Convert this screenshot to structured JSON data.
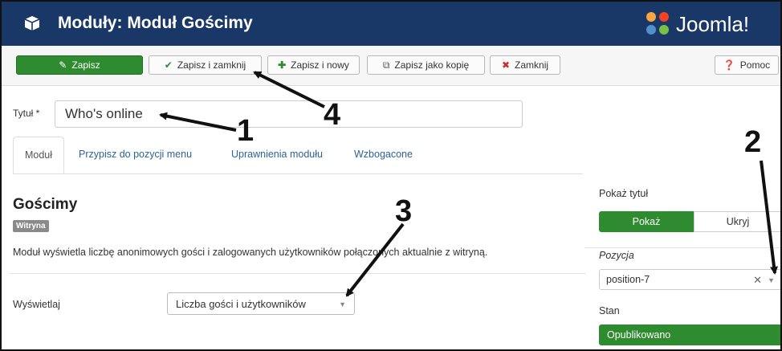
{
  "header": {
    "title": "Moduły: Moduł Gościmy",
    "brand": "Joomla!"
  },
  "toolbar": {
    "save": "Zapisz",
    "save_close": "Zapisz i zamknij",
    "save_new": "Zapisz i nowy",
    "save_copy": "Zapisz jako kopię",
    "close": "Zamknij",
    "help": "Pomoc"
  },
  "form": {
    "title_label": "Tytuł *",
    "title_value": "Who's online"
  },
  "tabs": [
    "Moduł",
    "Przypisz do pozycji menu",
    "Uprawnienia modułu",
    "Wzbogacone"
  ],
  "module": {
    "name": "Gościmy",
    "badge": "Witryna",
    "description": "Moduł wyświetla liczbę anonimowych gości i zalogowanych użytkowników połączonych aktualnie z witryną.",
    "display_label": "Wyświetlaj",
    "display_value": "Liczba gości i użytkowników"
  },
  "sidebar": {
    "show_title_label": "Pokaż tytuł",
    "show_label": "Pokaż",
    "hide_label": "Ukryj",
    "position_label": "Pozycja",
    "position_value": "position-7",
    "state_label": "Stan",
    "state_value": "Opublikowano"
  },
  "annotations": [
    "1",
    "2",
    "3",
    "4"
  ],
  "colors": {
    "header_bg": "#1a3867",
    "success": "#2f8b2f",
    "link": "#2a6496"
  },
  "icons": {
    "header": "cube-icon",
    "save": "edit-icon",
    "save_close": "check-icon",
    "save_new": "plus-icon",
    "save_copy": "copy-icon",
    "close": "cancel-icon",
    "help": "question-icon"
  }
}
